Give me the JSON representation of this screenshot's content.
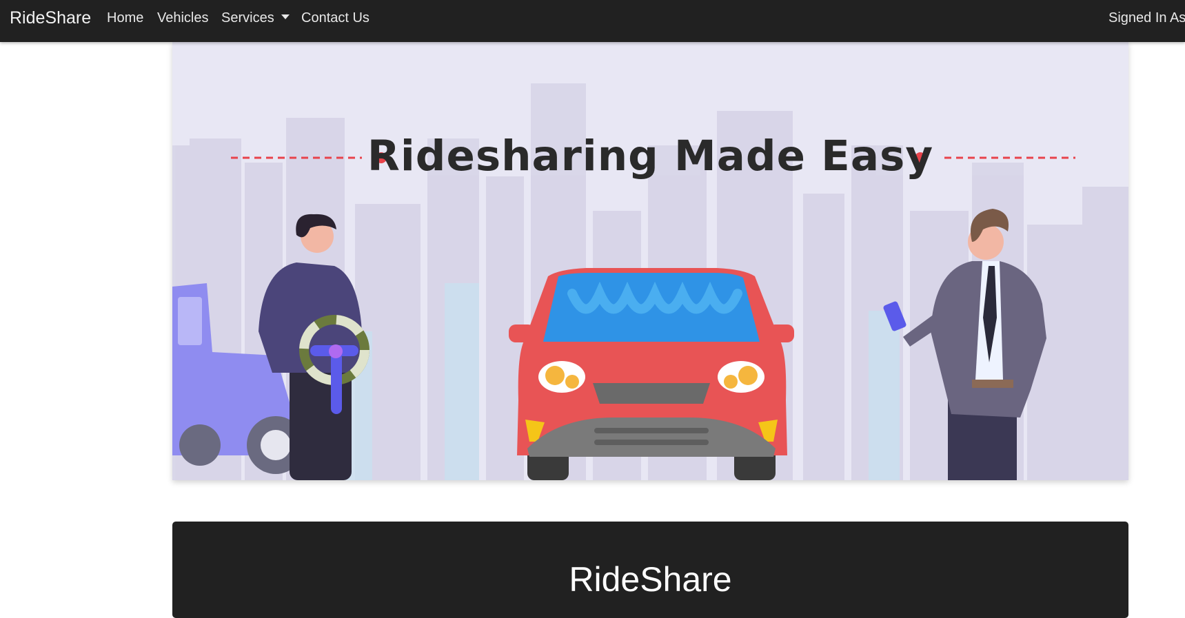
{
  "navbar": {
    "brand": "RideShare",
    "items": [
      {
        "label": "Home"
      },
      {
        "label": "Vehicles"
      },
      {
        "label": "Services"
      },
      {
        "label": "Contact Us"
      }
    ],
    "signed_in": "Signed In As"
  },
  "hero": {
    "title": "Ridesharing Made Easy"
  },
  "footer": {
    "title": "RideShare"
  },
  "colors": {
    "navbar_bg": "#212121",
    "hero_bg": "#e8e7f4",
    "accent_red": "#e8434b",
    "car_red": "#e85455",
    "windshield_blue": "#2f93e6"
  }
}
